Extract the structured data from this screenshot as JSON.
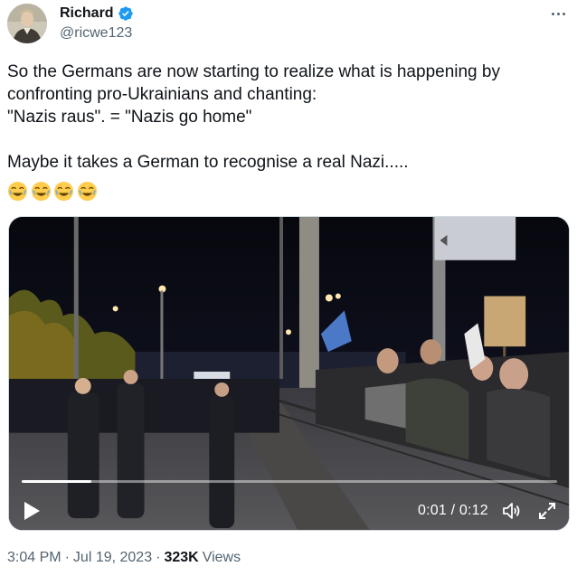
{
  "author": {
    "display_name": "Richard",
    "handle": "@ricwe123",
    "verified": true,
    "avatar_icon": "profile-avatar"
  },
  "more_menu_icon": "ellipsis-icon",
  "tweet": {
    "lines": [
      "So the Germans are now starting to realize what is happening by",
      "confronting pro-Ukrainians and chanting:",
      "\"Nazis raus\". = \"Nazis go home\"",
      "",
      "Maybe it takes a German to recognise a real Nazi.....",
      "😂😂😂😂"
    ]
  },
  "video": {
    "time_display": "0:01 / 0:12",
    "progress": 0.13,
    "play_icon": "play-icon",
    "volume_icon": "volume-icon",
    "fullscreen_icon": "fullscreen-icon"
  },
  "meta": {
    "time": "3:04 PM",
    "date": "Jul 19, 2023",
    "views_count": "323K",
    "views_label": "Views"
  },
  "colors": {
    "verified": "#1d9bf0",
    "secondary_text": "#536471",
    "primary_text": "#0f1419"
  }
}
